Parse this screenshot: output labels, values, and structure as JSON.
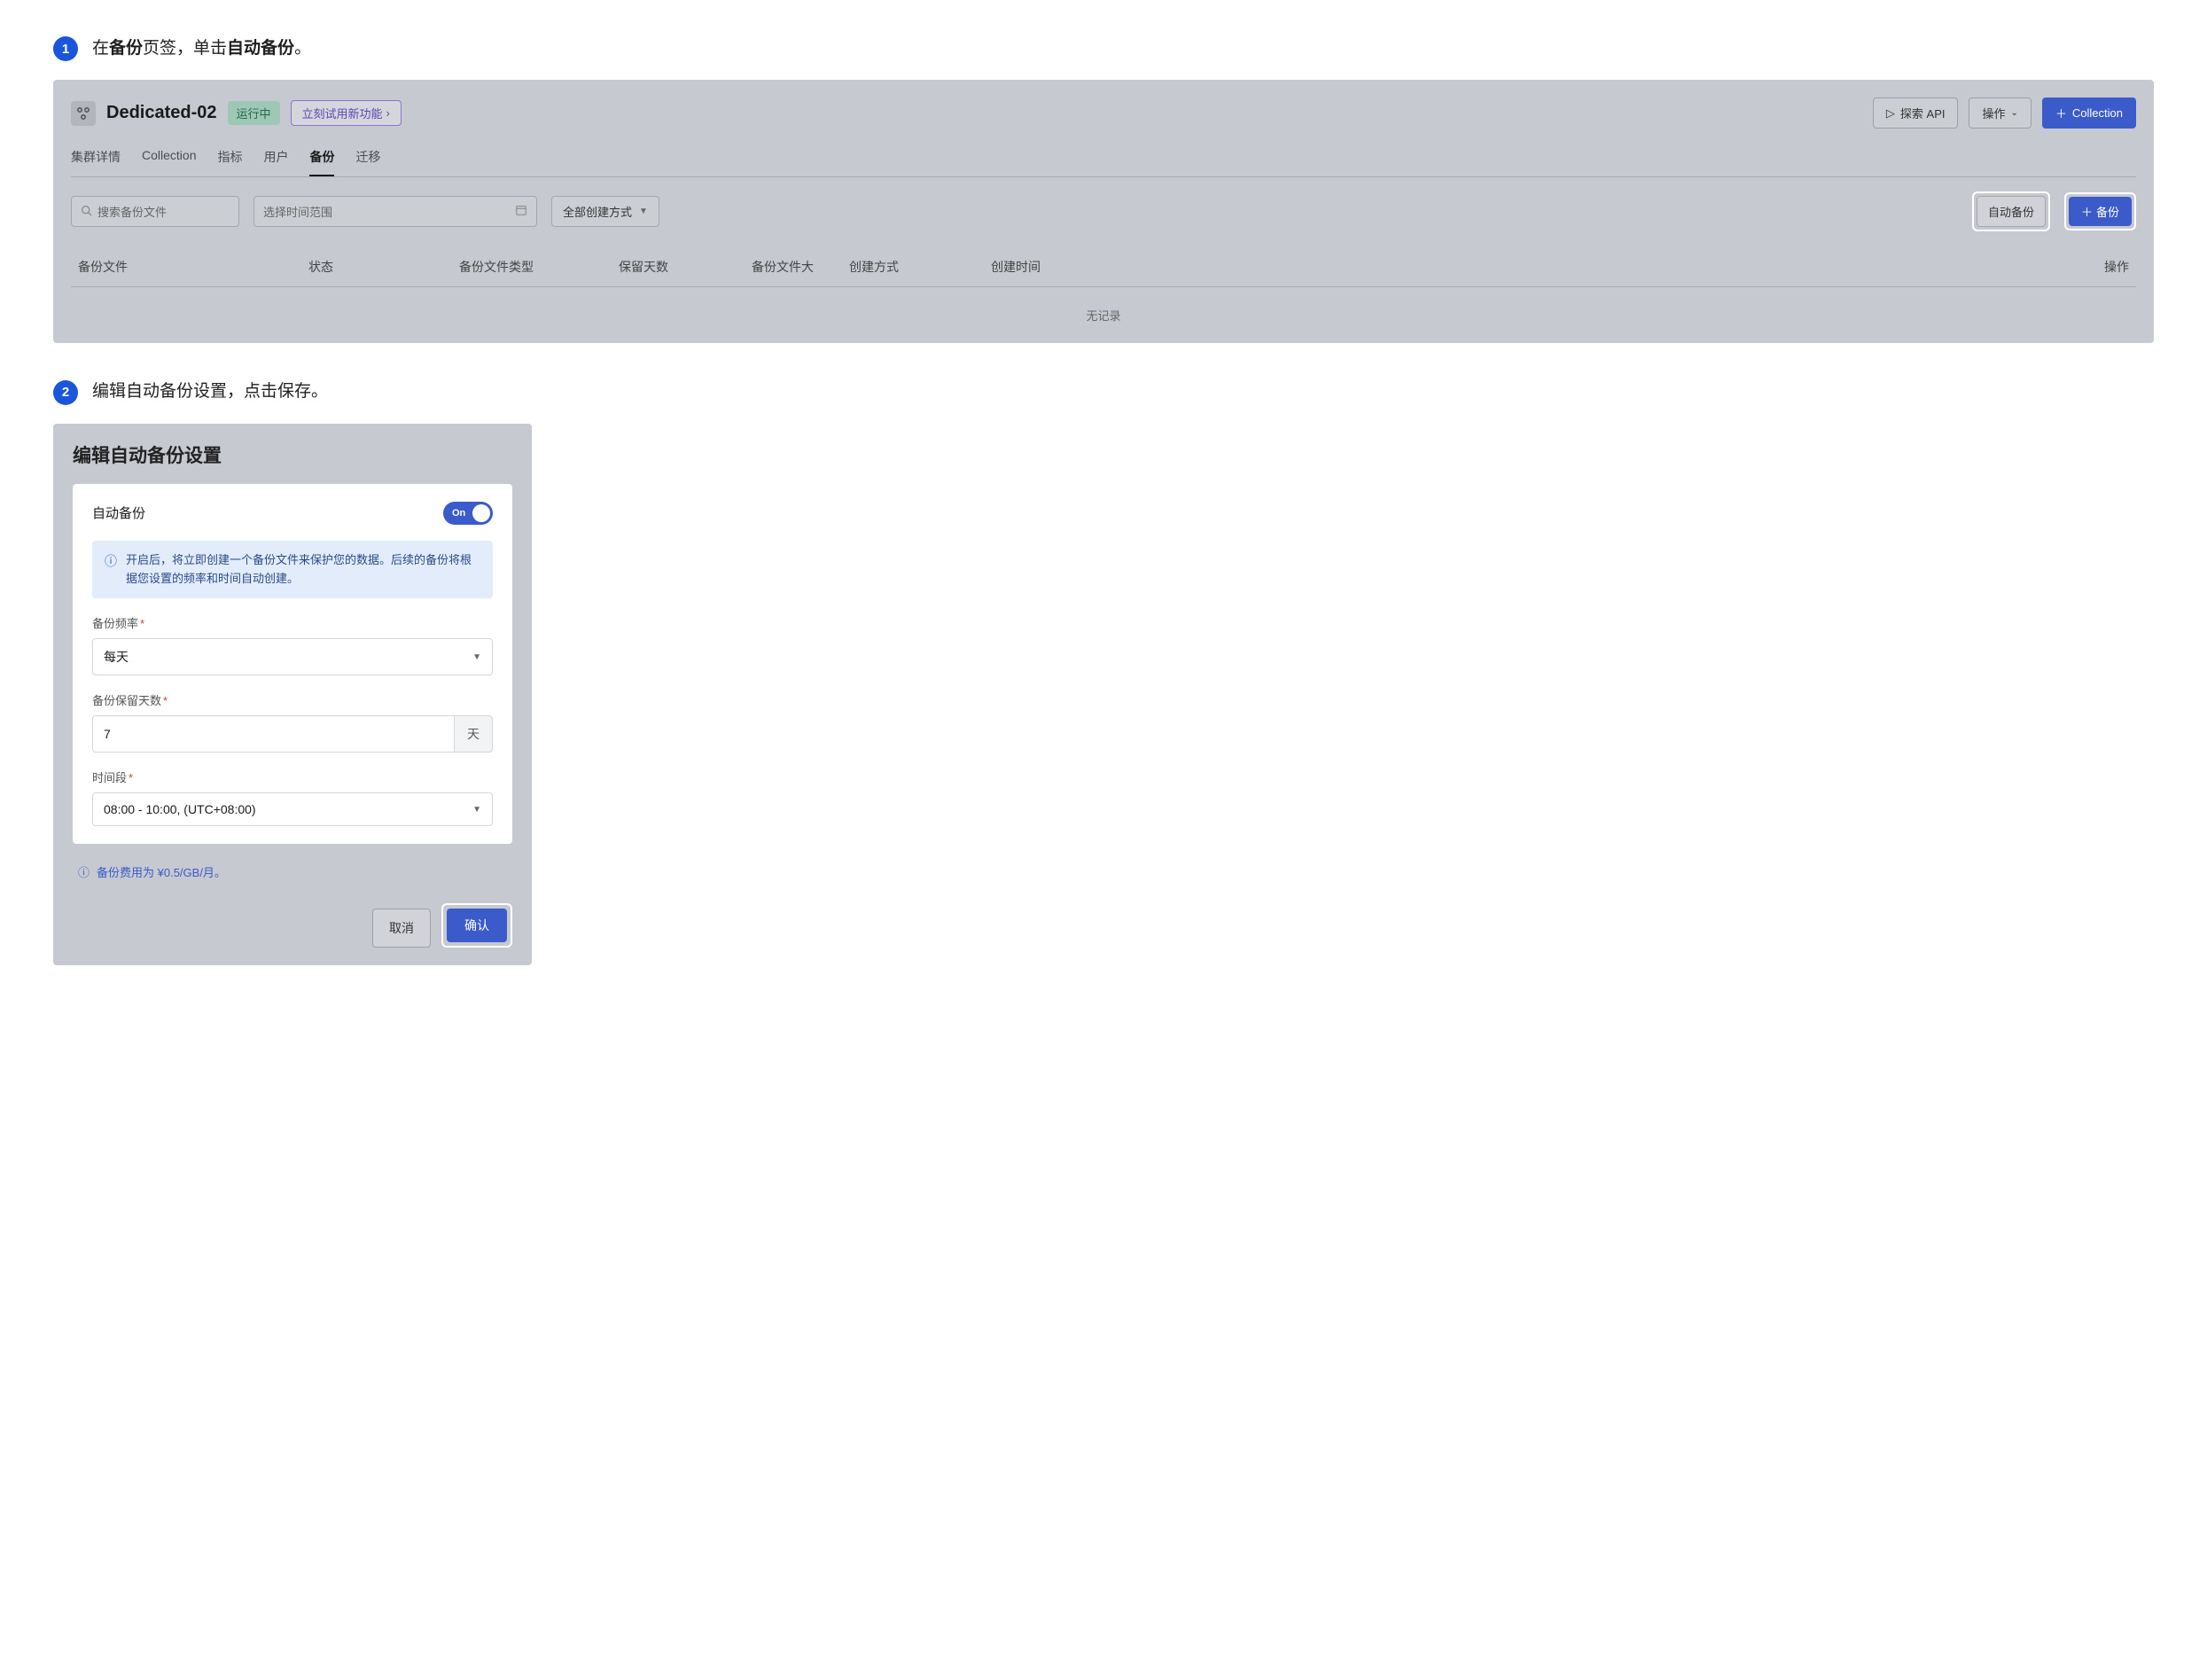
{
  "step1": {
    "num": "1",
    "text_prefix": "在",
    "text_bold1": "备份",
    "text_mid": "页签，单击",
    "text_bold2": "自动备份",
    "text_suffix": "。"
  },
  "step2": {
    "num": "2",
    "text": "编辑自动备份设置，点击保存。"
  },
  "screenshot1": {
    "cluster_name": "Dedicated-02",
    "status": "运行中",
    "try_feature": "立刻试用新功能",
    "explore_api_btn": "探索 API",
    "ops_btn": "操作",
    "collection_btn": "Collection",
    "tabs": [
      "集群详情",
      "Collection",
      "指标",
      "用户",
      "备份",
      "迁移"
    ],
    "active_tab_index": 4,
    "search_placeholder": "搜索备份文件",
    "date_placeholder": "选择时间范围",
    "method_select": "全部创建方式",
    "auto_backup_btn": "自动备份",
    "backup_btn": "备份",
    "table_headers": {
      "file": "备份文件",
      "status": "状态",
      "type": "备份文件类型",
      "days": "保留天数",
      "size": "备份文件大",
      "method": "创建方式",
      "time": "创建时间",
      "ops": "操作"
    },
    "no_records": "无记录"
  },
  "modal": {
    "title": "编辑自动备份设置",
    "toggle_label": "自动备份",
    "toggle_state": "On",
    "info_text": "开启后，将立即创建一个备份文件来保护您的数据。后续的备份将根据您设置的频率和时间自动创建。",
    "freq_label": "备份频率",
    "freq_value": "每天",
    "retain_label": "备份保留天数",
    "retain_value": "7",
    "retain_unit": "天",
    "time_label": "时间段",
    "time_value": "08:00 - 10:00, (UTC+08:00)",
    "price_note": "备份费用为 ¥0.5/GB/月。",
    "cancel_btn": "取消",
    "confirm_btn": "确认"
  }
}
